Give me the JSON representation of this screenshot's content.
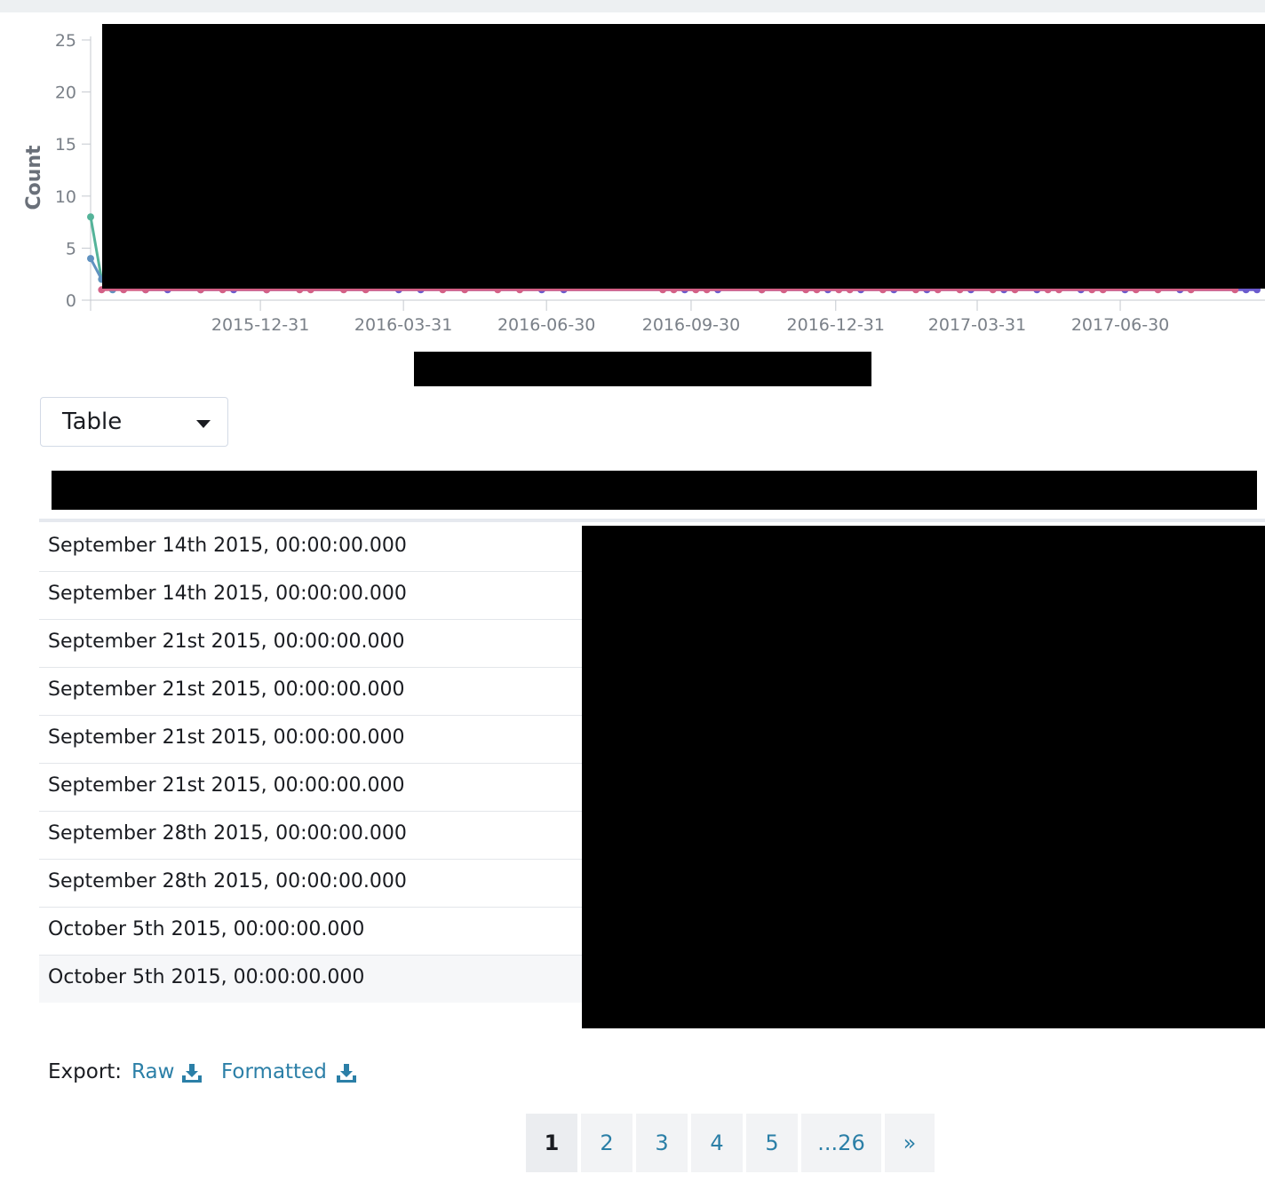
{
  "chart_data": {
    "type": "line",
    "ylabel": "Count",
    "xlabel": "",
    "ylim": [
      0,
      25
    ],
    "yticks": [
      0,
      5,
      10,
      15,
      20,
      25
    ],
    "xticks": [
      "2015-12-31",
      "2016-03-31",
      "2016-06-30",
      "2016-09-30",
      "2016-12-31",
      "2017-03-31",
      "2017-06-30"
    ],
    "xlim": [
      "2015-09-14",
      "2017-09-25"
    ],
    "series": [
      {
        "color": "#54b399",
        "points": [
          [
            "2015-09-14",
            8
          ],
          [
            "2015-09-21",
            2
          ]
        ]
      },
      {
        "color": "#6092c0",
        "points": [
          [
            "2015-09-14",
            4
          ],
          [
            "2015-09-21",
            2
          ],
          [
            "2015-09-28",
            1
          ]
        ]
      },
      {
        "color": "#6a5acd",
        "points": [
          [
            "2015-10-19",
            1
          ],
          [
            "2015-11-02",
            1
          ],
          [
            "2015-11-23",
            1
          ],
          [
            "2015-12-14",
            1
          ],
          [
            "2016-01-04",
            1
          ],
          [
            "2016-03-28",
            1
          ],
          [
            "2016-04-11",
            1
          ],
          [
            "2016-06-27",
            1
          ],
          [
            "2016-07-11",
            1
          ],
          [
            "2016-09-26",
            1
          ],
          [
            "2016-10-17",
            1
          ],
          [
            "2016-11-14",
            1
          ],
          [
            "2016-12-26",
            1
          ],
          [
            "2017-01-16",
            1
          ],
          [
            "2017-02-06",
            1
          ],
          [
            "2017-02-27",
            1
          ],
          [
            "2017-03-27",
            1
          ],
          [
            "2017-04-17",
            1
          ],
          [
            "2017-05-08",
            1
          ],
          [
            "2017-06-05",
            1
          ],
          [
            "2017-07-03",
            1
          ],
          [
            "2017-08-07",
            1
          ],
          [
            "2017-09-18",
            1
          ],
          [
            "2017-09-25",
            1
          ]
        ]
      },
      {
        "color": "#d36086",
        "points": [
          [
            "2015-09-21",
            1
          ],
          [
            "2015-10-05",
            1
          ],
          [
            "2015-10-19",
            1
          ],
          [
            "2015-11-23",
            1
          ],
          [
            "2015-12-07",
            1
          ],
          [
            "2016-01-04",
            1
          ],
          [
            "2016-01-25",
            1
          ],
          [
            "2016-02-01",
            1
          ],
          [
            "2016-02-22",
            1
          ],
          [
            "2016-03-07",
            1
          ],
          [
            "2016-04-25",
            1
          ],
          [
            "2016-05-09",
            1
          ],
          [
            "2016-05-30",
            1
          ],
          [
            "2016-06-13",
            1
          ],
          [
            "2016-09-12",
            1
          ],
          [
            "2016-09-19",
            1
          ],
          [
            "2016-10-03",
            1
          ],
          [
            "2016-10-10",
            1
          ],
          [
            "2016-11-14",
            1
          ],
          [
            "2016-11-28",
            1
          ],
          [
            "2016-12-12",
            1
          ],
          [
            "2016-12-19",
            1
          ],
          [
            "2017-01-02",
            1
          ],
          [
            "2017-01-09",
            1
          ],
          [
            "2017-01-30",
            1
          ],
          [
            "2017-02-20",
            1
          ],
          [
            "2017-03-06",
            1
          ],
          [
            "2017-03-20",
            1
          ],
          [
            "2017-04-10",
            1
          ],
          [
            "2017-04-24",
            1
          ],
          [
            "2017-05-15",
            1
          ],
          [
            "2017-05-22",
            1
          ],
          [
            "2017-06-12",
            1
          ],
          [
            "2017-06-19",
            1
          ],
          [
            "2017-07-10",
            1
          ],
          [
            "2017-07-24",
            1
          ],
          [
            "2017-08-14",
            1
          ],
          [
            "2017-09-11",
            1
          ]
        ]
      }
    ]
  },
  "view_select": {
    "value": "Table"
  },
  "table": {
    "rows": [
      "September 14th 2015, 00:00:00.000",
      "September 14th 2015, 00:00:00.000",
      "September 21st 2015, 00:00:00.000",
      "September 21st 2015, 00:00:00.000",
      "September 21st 2015, 00:00:00.000",
      "September 21st 2015, 00:00:00.000",
      "September 28th 2015, 00:00:00.000",
      "September 28th 2015, 00:00:00.000",
      "October 5th 2015, 00:00:00.000",
      "October 5th 2015, 00:00:00.000"
    ]
  },
  "export": {
    "label": "Export:",
    "raw": "Raw",
    "formatted": "Formatted"
  },
  "pagination": {
    "pages": [
      "1",
      "2",
      "3",
      "4",
      "5",
      "...26"
    ],
    "next": "»",
    "active": "1"
  },
  "icons": {
    "download": "download-icon",
    "caret": "caret-down-icon"
  }
}
